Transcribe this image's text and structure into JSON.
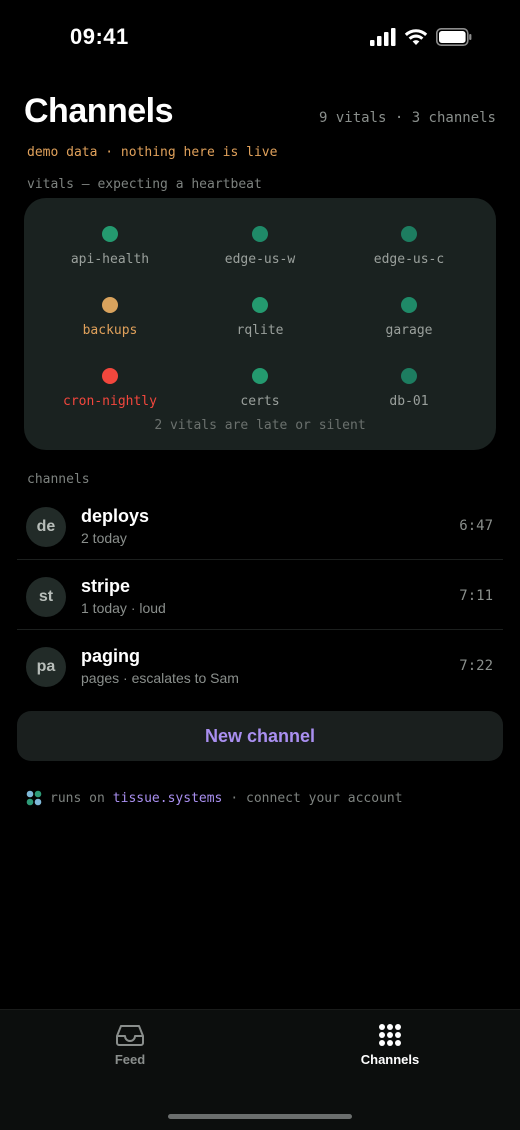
{
  "status_bar": {
    "time": "09:41"
  },
  "header": {
    "title": "Channels",
    "summary": "9 vitals · 3 channels",
    "demo_note": "demo data · nothing here is live"
  },
  "vitals": {
    "heading": "vitals — expecting a heartbeat",
    "items": [
      {
        "name": "api-health",
        "status": "ok",
        "color": "#249a6f"
      },
      {
        "name": "edge-us-w",
        "status": "ok",
        "color": "#1f8a68"
      },
      {
        "name": "edge-us-c",
        "status": "ok",
        "color": "#1d7d60"
      },
      {
        "name": "backups",
        "status": "late",
        "color": "#d9a35d"
      },
      {
        "name": "rqlite",
        "status": "ok",
        "color": "#249a6f"
      },
      {
        "name": "garage",
        "status": "ok",
        "color": "#1f8a68"
      },
      {
        "name": "cron-nightly",
        "status": "silent",
        "color": "#f2473d"
      },
      {
        "name": "certs",
        "status": "ok",
        "color": "#249a6f"
      },
      {
        "name": "db-01",
        "status": "ok",
        "color": "#1d7d60"
      }
    ],
    "summary": "2 vitals are late or silent"
  },
  "colors": {
    "late_text": "#e0a15b",
    "silent_text": "#f2473d",
    "accent": "#a98ff0"
  },
  "channels": {
    "heading": "channels",
    "items": [
      {
        "initials": "de",
        "name": "deploys",
        "subtitle": "2 today",
        "time": "6:47"
      },
      {
        "initials": "st",
        "name": "stripe",
        "subtitle": "1 today · loud",
        "time": "7:11"
      },
      {
        "initials": "pa",
        "name": "paging",
        "subtitle": "pages · escalates to Sam",
        "time": "7:22"
      }
    ],
    "new_button": "New channel"
  },
  "footer": {
    "prefix": "runs on",
    "link": "tissue.systems",
    "suffix": "· connect your account"
  },
  "tabs": [
    {
      "label": "Feed",
      "icon": "inbox-icon",
      "active": false
    },
    {
      "label": "Channels",
      "icon": "grid-icon",
      "active": true
    }
  ]
}
